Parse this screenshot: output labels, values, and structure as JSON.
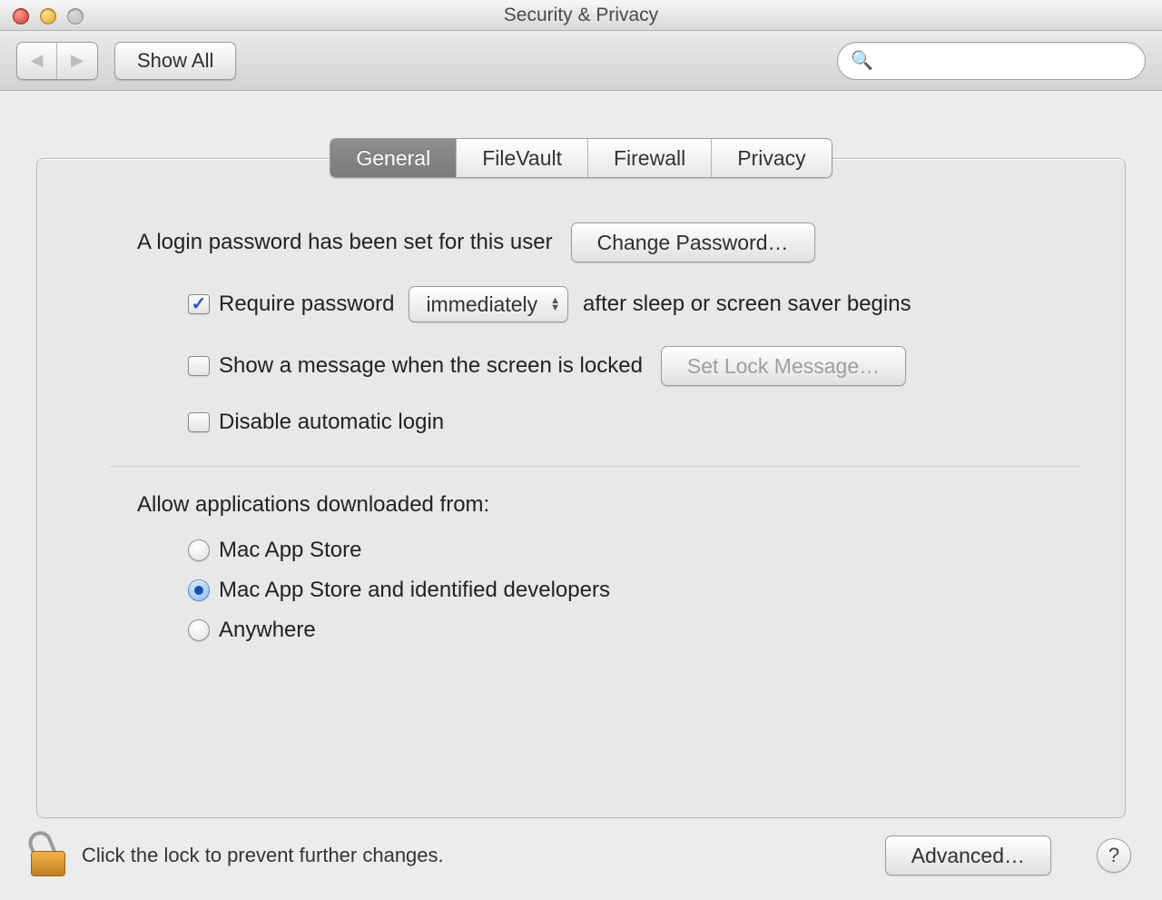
{
  "window": {
    "title": "Security & Privacy"
  },
  "toolbar": {
    "show_all_label": "Show All",
    "search_placeholder": ""
  },
  "tabs": [
    {
      "label": "General",
      "active": true
    },
    {
      "label": "FileVault",
      "active": false
    },
    {
      "label": "Firewall",
      "active": false
    },
    {
      "label": "Privacy",
      "active": false
    }
  ],
  "general": {
    "login_password_text": "A login password has been set for this user",
    "change_password_label": "Change Password…",
    "require_password_label": "Require password",
    "require_password_checked": true,
    "require_delay_selected": "immediately",
    "require_password_suffix": "after sleep or screen saver begins",
    "show_lock_message_label": "Show a message when the screen is locked",
    "show_lock_message_checked": false,
    "set_lock_message_label": "Set Lock Message…",
    "disable_auto_login_label": "Disable automatic login",
    "disable_auto_login_checked": false,
    "gatekeeper_title": "Allow applications downloaded from:",
    "gatekeeper_options": [
      {
        "label": "Mac App Store",
        "selected": false
      },
      {
        "label": "Mac App Store and identified developers",
        "selected": true
      },
      {
        "label": "Anywhere",
        "selected": false
      }
    ]
  },
  "footer": {
    "lock_text": "Click the lock to prevent further changes.",
    "advanced_label": "Advanced…",
    "help_label": "?"
  }
}
